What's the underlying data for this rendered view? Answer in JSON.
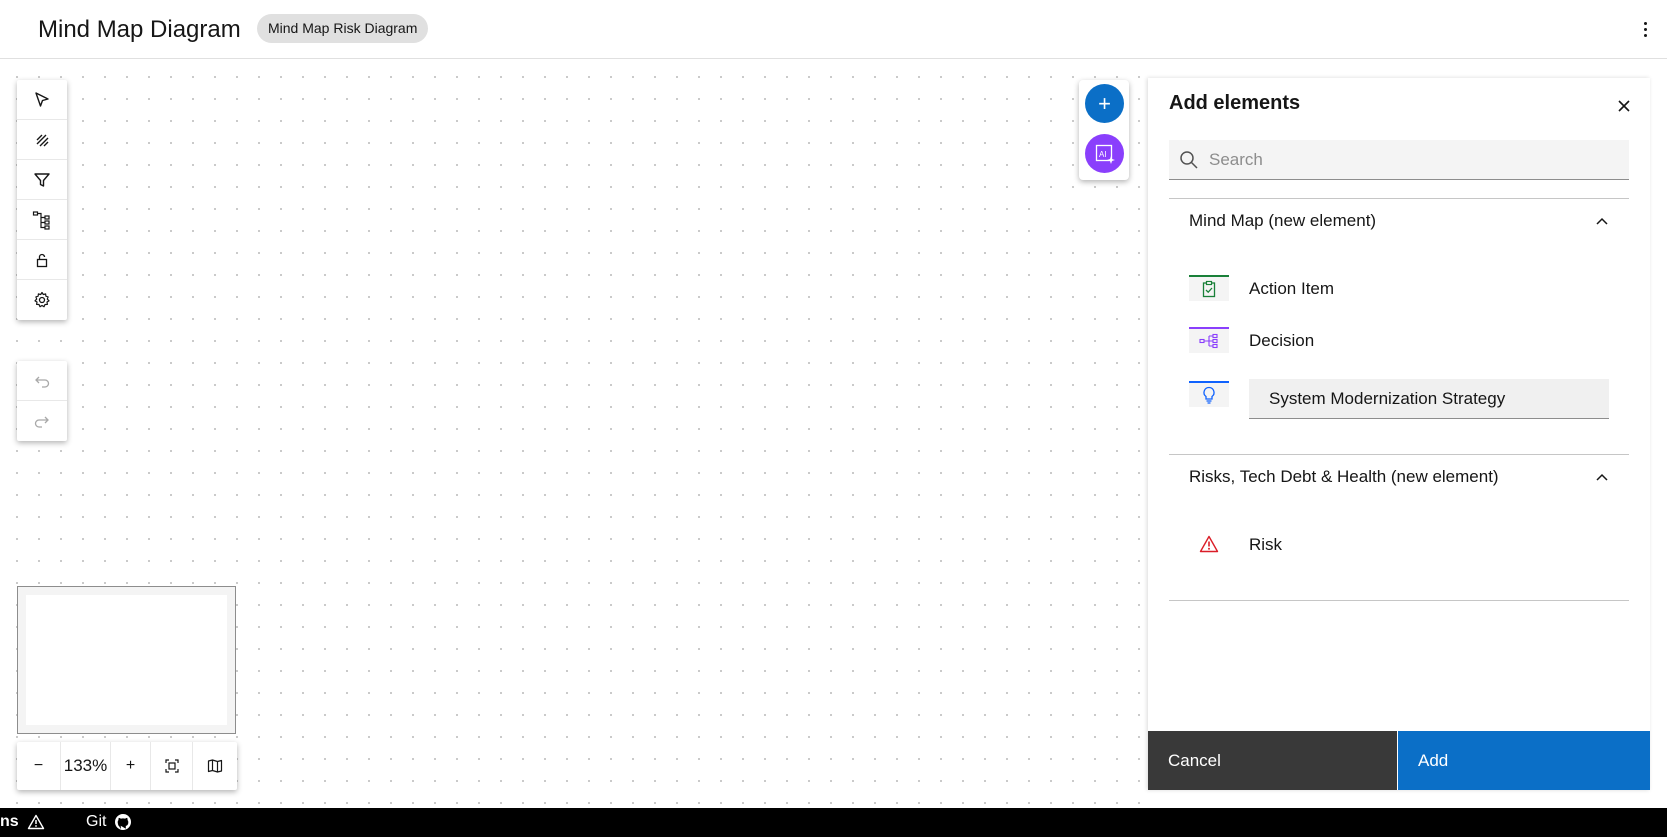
{
  "header": {
    "title": "Mind Map Diagram",
    "tag": "Mind Map Risk Diagram"
  },
  "zoom": {
    "minus": "−",
    "level": "133%",
    "plus": "+"
  },
  "fab": {
    "add": "+",
    "ai": "AI"
  },
  "panel": {
    "title": "Add elements",
    "search_placeholder": "Search",
    "sections": [
      {
        "title": "Mind Map (new element)",
        "items": [
          {
            "label": "Action Item",
            "icon": "clipboard-check-icon",
            "color": "#198038"
          },
          {
            "label": "Decision",
            "icon": "decision-tree-icon",
            "color": "#8a3ffc"
          },
          {
            "label": "System Modernization Strategy",
            "icon": "lightbulb-icon",
            "color": "#0f62fe"
          }
        ]
      },
      {
        "title": "Risks, Tech Debt & Health (new element)",
        "items": [
          {
            "label": "Risk",
            "icon": "warning-triangle-icon",
            "color": "#da1e28"
          }
        ]
      }
    ],
    "cancel_label": "Cancel",
    "add_label": "Add"
  },
  "statusbar": {
    "left_text": "ns",
    "git_label": "Git"
  },
  "colors": {
    "primary": "#0b6fc7",
    "ai": "#8a3ffc",
    "dark_button": "#393939"
  }
}
